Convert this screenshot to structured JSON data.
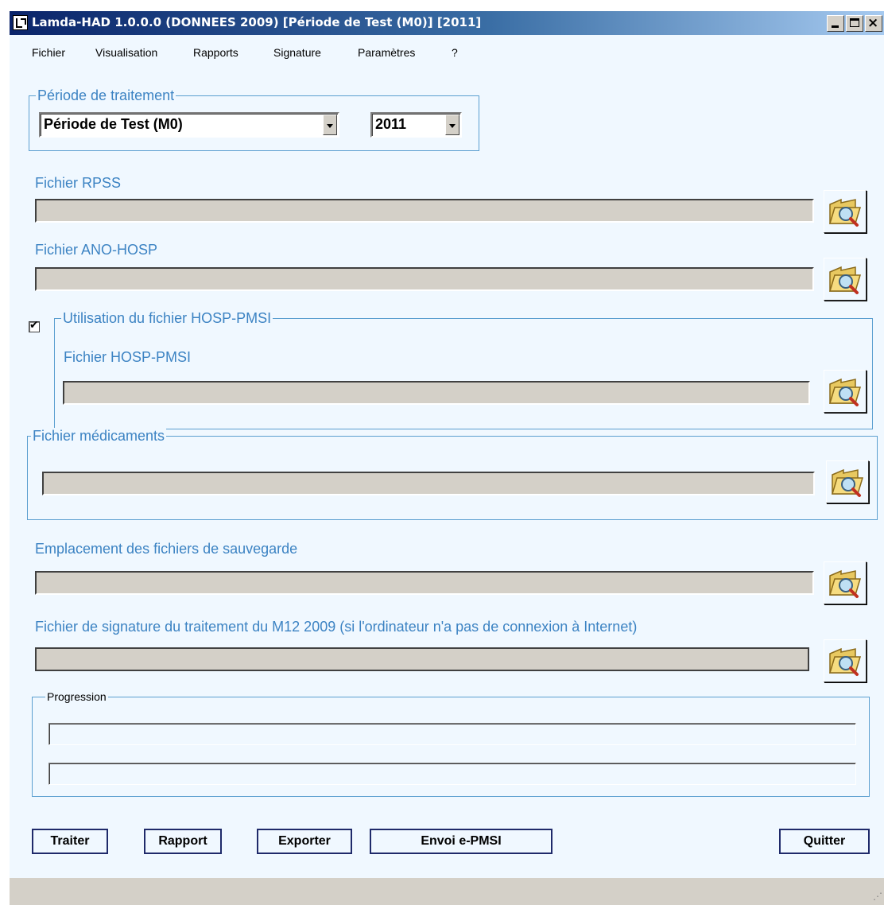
{
  "window": {
    "title": "Lamda-HAD 1.0.0.0 (DONNEES 2009) [Période de Test (M0)] [2011]",
    "controls": {
      "minimize": "_",
      "maximize": "□",
      "close": "×"
    }
  },
  "menu": [
    "Fichier",
    "Visualisation",
    "Rapports",
    "Signature",
    "Paramètres",
    "?"
  ],
  "periode": {
    "legend": "Période de traitement",
    "period_value": "Période de Test (M0)",
    "year_value": "2011"
  },
  "rpss": {
    "label": "Fichier RPSS",
    "value": ""
  },
  "ano_hosp": {
    "label": "Fichier ANO-HOSP",
    "value": ""
  },
  "hosp_pmsi": {
    "checkbox_checked": true,
    "checkbox_mark": "✔",
    "legend": "Utilisation du fichier HOSP-PMSI",
    "label": "Fichier HOSP-PMSI",
    "value": ""
  },
  "medicaments": {
    "legend": "Fichier médicaments",
    "value": ""
  },
  "sauvegarde": {
    "label": "Emplacement des fichiers de sauvegarde",
    "value": ""
  },
  "signature": {
    "label": "Fichier de signature du traitement du M12 2009 (si l'ordinateur n'a pas de connexion à Internet)",
    "value": ""
  },
  "progression": {
    "legend": "Progression",
    "bar1_fraction": 0,
    "bar2_fraction": 0
  },
  "buttons": {
    "traiter": "Traiter",
    "rapport": "Rapport",
    "exporter": "Exporter",
    "envoi": "Envoi e-PMSI",
    "quitter": "Quitter"
  },
  "colors": {
    "label_blue": "#3c83c3",
    "frame_blue": "#5b9fd0",
    "background": "#f0f8ff",
    "input_gray": "#d4d0c8",
    "titlebar_start": "#0a246a"
  },
  "icons": {
    "browse": "folder-search-icon",
    "grip": "resize-grip-icon"
  }
}
